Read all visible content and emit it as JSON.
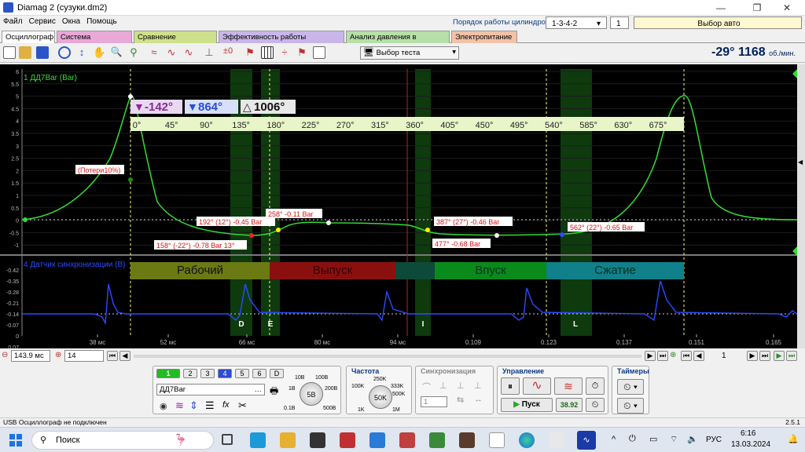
{
  "app": {
    "title": "Diamag 2 (сузуки.dm2)"
  },
  "menu": [
    "Файл",
    "Сервис",
    "Окна",
    "Помощь"
  ],
  "header": {
    "cyl_order_label": "Порядок работы цилиндров",
    "cyl_order_value": "1-3-4-2",
    "cyl_num": "1",
    "auto_select": "Выбор авто"
  },
  "tabs": [
    {
      "label": "Осциллограф",
      "color": "#ffffff"
    },
    {
      "label": "Система зажигания",
      "color": "#e8a8d8"
    },
    {
      "label": "Сравнение цилиндров",
      "color": "#cfe08a"
    },
    {
      "label": "Эффективность работы цилиндров",
      "color": "#c9b6e8"
    },
    {
      "label": "Анализ давления в цилиндре",
      "color": "#b6e0a8"
    },
    {
      "label": "Электропитание",
      "color": "#f2c2a8"
    }
  ],
  "toolbar": {
    "test_select": "Выбор теста"
  },
  "rpm": {
    "angle": "-29°",
    "value": "1168",
    "unit": "об./мин."
  },
  "scope": {
    "ch1_label": "1 ДД7Bar (Bar)",
    "ch2_label": "4 Датчик синхронизации (В)",
    "y1_ticks": [
      "6",
      "5.5",
      "5",
      "4.5",
      "4",
      "3.5",
      "3",
      "2.5",
      "2",
      "1.5",
      "1",
      "0.5",
      "0",
      "-0.5",
      "-1"
    ],
    "y2_ticks": [
      "-0.42",
      "-0.35",
      "-0.28",
      "-0.21",
      "-0.14",
      "-0.07",
      "0",
      "0.07",
      "0.14"
    ],
    "x_ticks": [
      "38 мс",
      "52 мс",
      "66 мс",
      "80 мс",
      "94 мс",
      "0.109",
      "0.123",
      "0.137",
      "0.151",
      "0.165"
    ],
    "angle_ticks": [
      "0°",
      "45°",
      "90°",
      "135°",
      "180°",
      "225°",
      "270°",
      "315°",
      "360°",
      "405°",
      "450°",
      "495°",
      "540°",
      "585°",
      "630°",
      "675°"
    ],
    "markers": {
      "m1": "-142°",
      "m2": "864°",
      "delta": "1006°"
    },
    "labels": [
      "(Потери10%)",
      "192° (12°) -0.45 Bar",
      "258° -0.11 Bar",
      "387° (27°) -0.46 Bar",
      "562° (22°) -0.65 Bar",
      "158° (-22°) -0.78 Bar 13°",
      "477° -0.68 Bar"
    ],
    "phases": [
      {
        "label": "Рабочий",
        "color": "#6b7a12"
      },
      {
        "label": "Выпуск",
        "color": "#8a1010"
      },
      {
        "label": "Впуск",
        "color": "#0a8a1a"
      },
      {
        "label": "Сжатие",
        "color": "#10808a"
      }
    ],
    "events": [
      "D",
      "E",
      "I",
      "L"
    ]
  },
  "controls": {
    "timebase": "143.9 мс",
    "ch_num": "14",
    "page": "1"
  },
  "panel": {
    "channels": [
      "1",
      "2",
      "3",
      "4",
      "5",
      "6",
      "D"
    ],
    "sensor": "ДД7Bar",
    "volt_title": "",
    "volt_ticks": [
      "10В",
      "100В",
      "1В",
      "200В",
      "0.1В",
      "500В"
    ],
    "volt_value": "5В",
    "freq_title": "Частота",
    "freq_ticks": [
      "250K",
      "100K",
      "333K",
      "500K",
      "1K",
      "1M"
    ],
    "freq_value": "50K",
    "sync_title": "Синхронизация",
    "sync_value": "1",
    "control_title": "Управление",
    "start": "Пуск",
    "counter": "38.92",
    "timers_title": "Таймеры"
  },
  "status": {
    "left": "USB Осциллограф не подключен",
    "right": "2.5.1"
  },
  "taskbar": {
    "search": "Поиск",
    "lang": "РУС",
    "time": "6:16",
    "date": "13.03.2024"
  }
}
